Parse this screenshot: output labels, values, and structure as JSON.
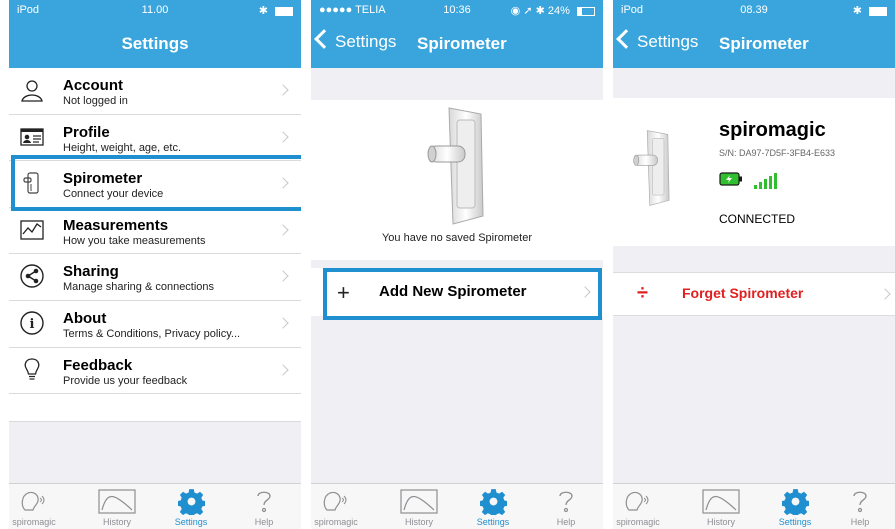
{
  "colors": {
    "accent": "#3aa5dc",
    "highlight": "#1f8fd0",
    "danger": "#e02020"
  },
  "tabs": [
    {
      "label": "spiromagic",
      "icon": "spiromagic-icon"
    },
    {
      "label": "History",
      "icon": "history-icon"
    },
    {
      "label": "Settings",
      "icon": "gear-icon",
      "active": true
    },
    {
      "label": "Help",
      "icon": "help-icon"
    }
  ],
  "screen1": {
    "status": {
      "carrier": "iPod",
      "time": "11.00"
    },
    "title": "Settings",
    "rows": [
      {
        "title": "Account",
        "subtitle": "Not logged in",
        "icon": "person-icon"
      },
      {
        "title": "Profile",
        "subtitle": "Height, weight, age, etc.",
        "icon": "id-card-icon"
      },
      {
        "title": "Spirometer",
        "subtitle": "Connect your device",
        "icon": "spirometer-icon"
      },
      {
        "title": "Measurements",
        "subtitle": "How you take measurements",
        "icon": "chart-icon"
      },
      {
        "title": "Sharing",
        "subtitle": "Manage sharing & connections",
        "icon": "share-icon"
      },
      {
        "title": "About",
        "subtitle": "Terms & Conditions, Privacy policy...",
        "icon": "info-icon"
      },
      {
        "title": "Feedback",
        "subtitle": "Provide us your feedback",
        "icon": "lightbulb-icon"
      }
    ]
  },
  "screen2": {
    "status": {
      "carrier": "●●●●● TELIA",
      "time": "10:36",
      "battery": "24%"
    },
    "back_label": "Settings",
    "title": "Spirometer",
    "empty_text": "You have no saved Spirometer",
    "add_label": "Add New Spirometer"
  },
  "screen3": {
    "status": {
      "carrier": "iPod",
      "time": "08.39"
    },
    "back_label": "Settings",
    "title": "Spirometer",
    "device": {
      "name": "spiromagic",
      "serial": "S/N: DA97-7D5F-3FB4-E633",
      "status": "CONNECTED"
    },
    "forget_label": "Forget Spirometer"
  }
}
